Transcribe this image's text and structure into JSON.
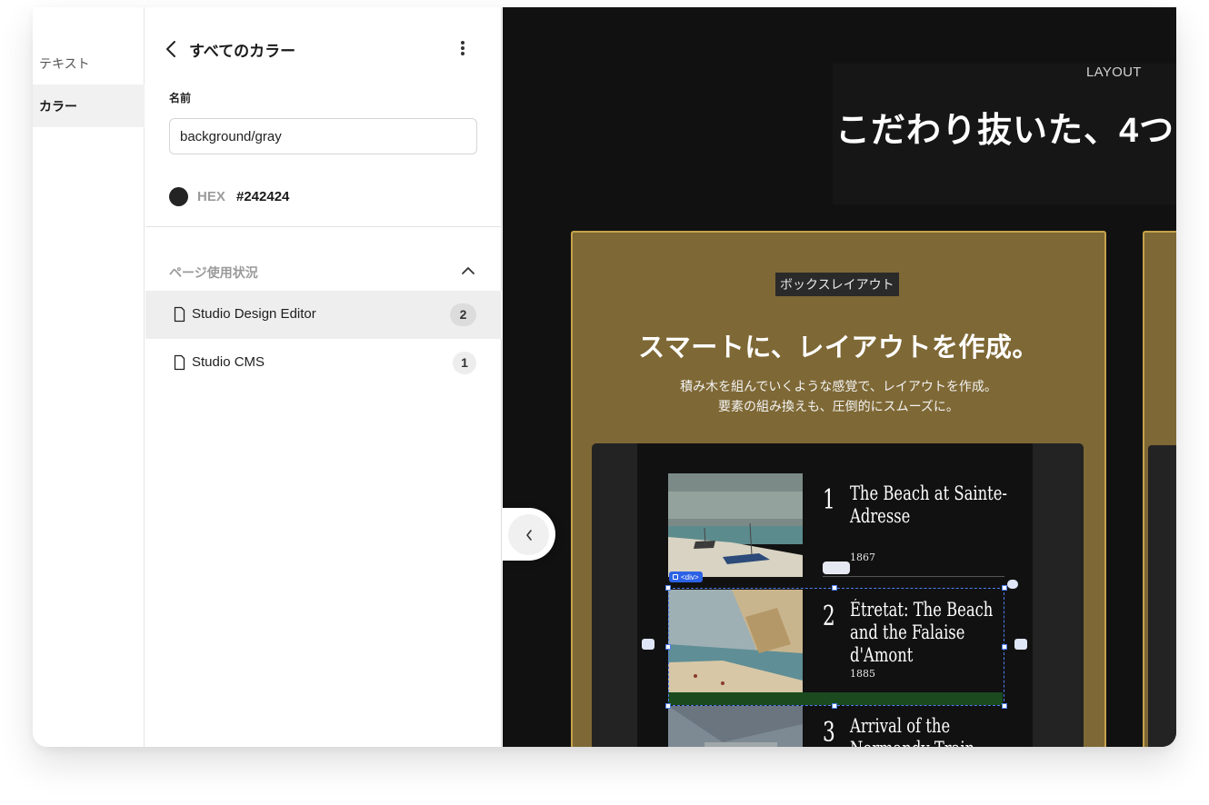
{
  "nav": {
    "items": [
      {
        "label": "テキスト",
        "active": false
      },
      {
        "label": "カラー",
        "active": true
      }
    ]
  },
  "panel": {
    "title": "すべてのカラー",
    "name_label": "名前",
    "name_value": "background/gray",
    "color": {
      "format_label": "HEX",
      "value": "#242424",
      "swatch": "#242424"
    },
    "usage": {
      "title": "ページ使用状況",
      "pages": [
        {
          "name": "Studio Design Editor",
          "count": "2",
          "highlighted": true
        },
        {
          "name": "Studio CMS",
          "count": "1",
          "highlighted": false
        }
      ]
    }
  },
  "canvas": {
    "hero": {
      "label": "LAYOUT",
      "heading": "こだわり抜いた、4つ"
    },
    "card": {
      "tag": "ボックスレイアウト",
      "heading": "スマートに、レイアウトを作成。",
      "desc_line1": "積み木を組んでいくような感覚で、レイアウトを作成。",
      "desc_line2": "要素の組み換えも、圧倒的にスムーズに。",
      "items": [
        {
          "number": "1",
          "title": "The Beach at Sainte-Adresse",
          "year": "1867"
        },
        {
          "number": "2",
          "title": "Étretat: The Beach and the Falaise d'Amont",
          "year": "1885"
        },
        {
          "number": "3",
          "title": "Arrival of the Normandy Train, Gare",
          "year": ""
        }
      ]
    },
    "selection_tag": "<div>"
  },
  "colors": {
    "accent_card": "#7e6835",
    "card_border": "#c5a24c",
    "selection": "#4f7df0"
  }
}
